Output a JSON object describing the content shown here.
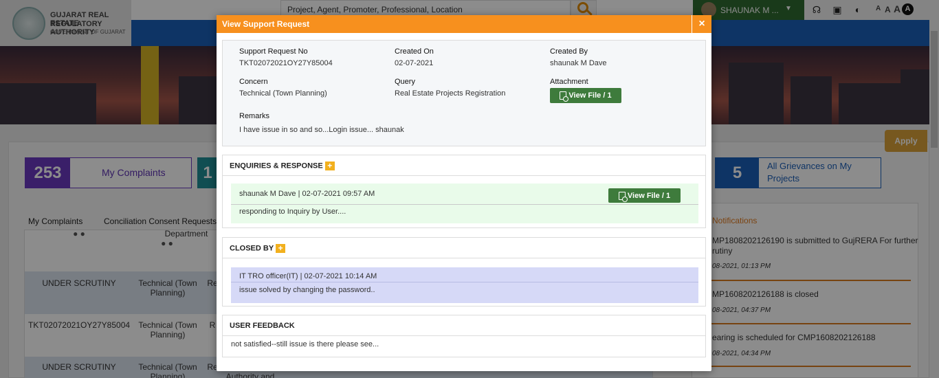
{
  "header": {
    "org_line1": "GUJARAT REAL ESTATE",
    "org_line2": "REGULATORY AUTHORITY",
    "org_line3": "GOVERNMENT OF GUJARAT",
    "search_placeholder": "Project, Agent, Promoter, Professional, Location",
    "user_name": "SHAUNAK M ...",
    "font_small": "A",
    "font_medium": "A",
    "font_large": "A",
    "font_contrast": "A"
  },
  "dashboard": {
    "apply_label": "Apply",
    "my_complaints_count": "253",
    "my_complaints_label": "My Complaints",
    "second_card_count": "1",
    "grievances_count": "5",
    "grievances_label": "All Grievances on My Projects",
    "tabs": [
      "My Complaints",
      "Conciliation Consent Requests fo"
    ],
    "department_header": "Department",
    "rows": [
      {
        "col1": "UNDER SCRUTINY",
        "col2": "Technical (Town Planning)",
        "col3": "Re"
      },
      {
        "col1": "TKT02072021OY27Y85004",
        "col2": "Technical (Town Planning)",
        "col3": "R"
      },
      {
        "col1": "UNDER SCRUTINY",
        "col2": "Technical (Town Planning)",
        "col3": "Re",
        "col4": "Authority and"
      }
    ],
    "notifications_title": "Notifications",
    "notifications": [
      {
        "text_line1": "MP1808202126190 is submitted to GujRERA For further",
        "text_line2": "rutiny",
        "date": "08-2021, 01:13 PM"
      },
      {
        "text_line1": "MP1608202126188 is closed",
        "date": "08-2021, 04:37 PM"
      },
      {
        "text_line1": "earing is scheduled for CMP1608202126188",
        "date": "08-2021, 04:34 PM"
      }
    ]
  },
  "modal": {
    "title": "View Support Request",
    "close_symbol": "×",
    "support_no_label": "Support Request No",
    "support_no_value": "TKT02072021OY27Y85004",
    "created_on_label": "Created On",
    "created_on_value": "02-07-2021",
    "created_by_label": "Created By",
    "created_by_value": "shaunak M Dave",
    "concern_label": "Concern",
    "concern_value": "Technical (Town Planning)",
    "query_label": "Query",
    "query_value": "Real Estate Projects Registration",
    "attachment_label": "Attachment",
    "view_file_label": "View File / 1",
    "remarks_label": "Remarks",
    "remarks_value": "I have issue in so and so...Login issue... shaunak",
    "enquiries": {
      "title": "ENQUIRIES & RESPONSE",
      "plus": "+",
      "entry_meta": "shaunak M Dave | 02-07-2021 09:57 AM",
      "entry_file_label": "View File / 1",
      "entry_body": "responding to Inquiry by User....",
      "bg_color": "#e9fbea"
    },
    "closed_by": {
      "title": "CLOSED BY",
      "plus": "+",
      "entry_meta": "IT TRO officer(IT) | 02-07-2021 10:14 AM",
      "entry_body": "issue solved by changing the password..",
      "bg_color": "#d6d9f7"
    },
    "feedback": {
      "title": "USER FEEDBACK",
      "body": "not satisfied--still issue is there please see..."
    }
  },
  "colors": {
    "modal_header": "#f7901e",
    "button_green": "#3e7b3c",
    "user_pill": "#2e6b31",
    "purple_card": "#6b39c0",
    "teal_card": "#1f8e95",
    "blue_card": "#1b5fb8"
  }
}
